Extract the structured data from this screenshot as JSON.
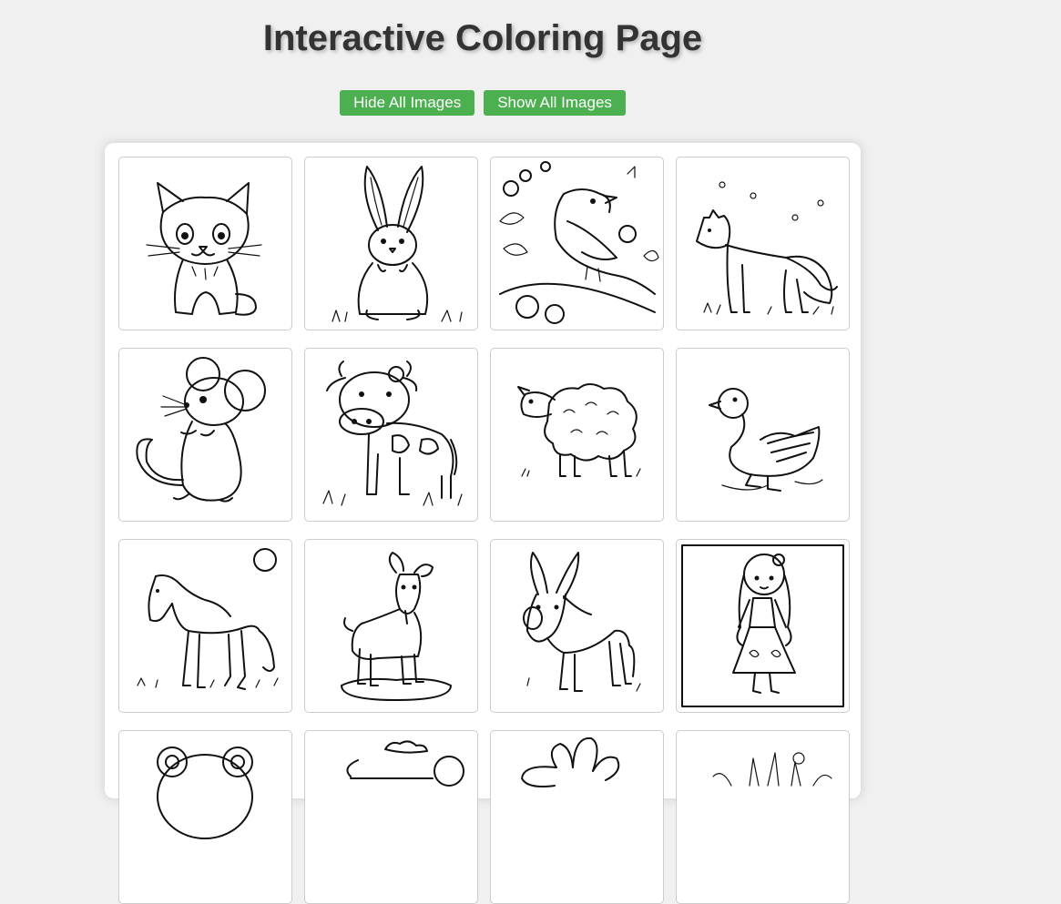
{
  "page": {
    "title": "Interactive Coloring Page"
  },
  "controls": {
    "hide_label": "Hide All Images",
    "show_label": "Show All Images"
  },
  "images": [
    {
      "subject": "cat"
    },
    {
      "subject": "rabbit"
    },
    {
      "subject": "bird"
    },
    {
      "subject": "fox"
    },
    {
      "subject": "mouse"
    },
    {
      "subject": "cow"
    },
    {
      "subject": "sheep"
    },
    {
      "subject": "duck"
    },
    {
      "subject": "horse"
    },
    {
      "subject": "goat"
    },
    {
      "subject": "donkey"
    },
    {
      "subject": "girl"
    },
    {
      "subject": "bear"
    },
    {
      "subject": "landscape"
    },
    {
      "subject": "flower"
    },
    {
      "subject": "plant"
    }
  ]
}
